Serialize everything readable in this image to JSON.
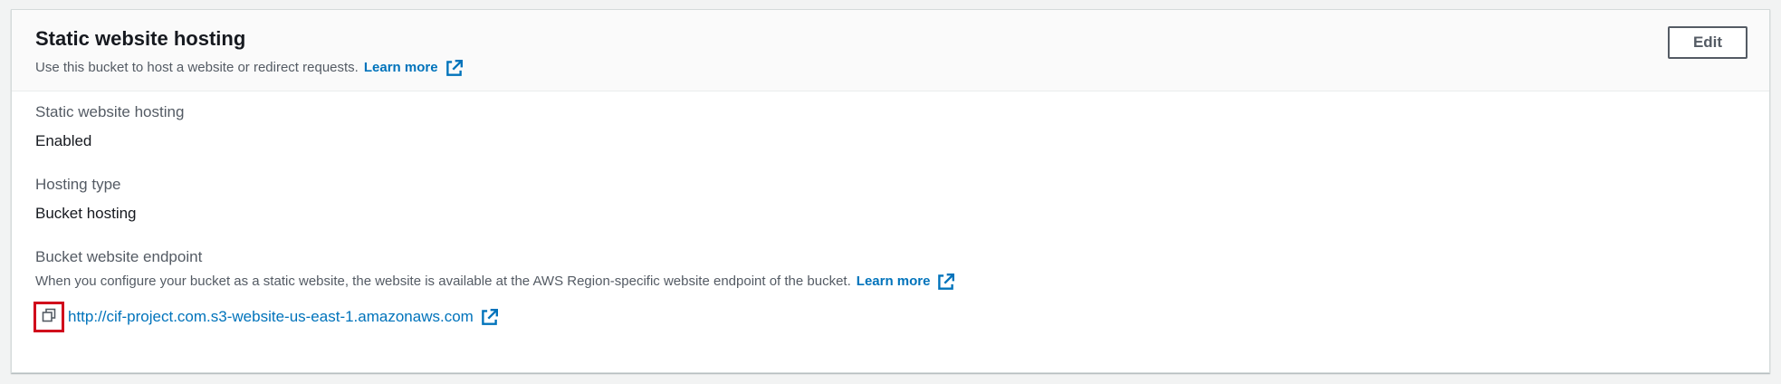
{
  "header": {
    "title": "Static website hosting",
    "description": "Use this bucket to host a website or redirect requests.",
    "learn_more": "Learn more",
    "edit_label": "Edit"
  },
  "fields": {
    "hosting": {
      "label": "Static website hosting",
      "value": "Enabled"
    },
    "hosting_type": {
      "label": "Hosting type",
      "value": "Bucket hosting"
    },
    "endpoint": {
      "label": "Bucket website endpoint",
      "description": "When you configure your bucket as a static website, the website is available at the AWS Region-specific website endpoint of the bucket.",
      "learn_more": "Learn more",
      "url": "http://cif-project.com.s3-website-us-east-1.amazonaws.com"
    }
  },
  "icons": {
    "external": "external-link-icon",
    "copy": "copy-icon"
  },
  "colors": {
    "link": "#0073bb",
    "highlight": "#d0021b",
    "text_secondary": "#545b64",
    "text_primary": "#16191f"
  }
}
